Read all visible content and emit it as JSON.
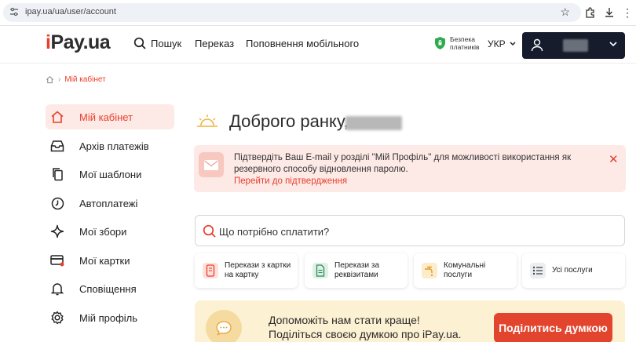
{
  "browser": {
    "url": "ipay.ua/ua/user/account"
  },
  "header": {
    "logo_prefix": "i",
    "logo_rest": "Pay.ua",
    "search_label": "Пошук",
    "nav": [
      "Переказ",
      "Поповнення мобільного"
    ],
    "safety_label": "Безпека платників",
    "language": "УКР"
  },
  "breadcrumb": {
    "current": "Мій кабінет"
  },
  "sidebar": {
    "items": [
      {
        "label": "Мій кабінет",
        "icon": "home-icon",
        "active": true
      },
      {
        "label": "Архів платежів",
        "icon": "inbox-icon",
        "active": false
      },
      {
        "label": "Мої шаблони",
        "icon": "copy-icon",
        "active": false
      },
      {
        "label": "Автоплатежі",
        "icon": "clock-icon",
        "active": false
      },
      {
        "label": "Мої збори",
        "icon": "sparkle-icon",
        "active": false
      },
      {
        "label": "Мої картки",
        "icon": "card-icon",
        "active": false
      },
      {
        "label": "Сповіщення",
        "icon": "bell-icon",
        "active": false
      },
      {
        "label": "Мій профіль",
        "icon": "gear-icon",
        "active": false
      }
    ]
  },
  "main": {
    "greeting": "Доброго ранку,",
    "alert": {
      "message": "Підтвердіть Ваш E-mail у розділі \"Мій Профіль\" для можливості використання як резервного способу відновлення паролю.",
      "link": "Перейти до підтвердження",
      "close": "✕"
    },
    "search_placeholder": "Що потрібно сплатити?",
    "services": [
      {
        "label": "Перекази з картки на картку",
        "icon": "card-transfer-icon"
      },
      {
        "label": "Перекази за реквізитами",
        "icon": "document-icon"
      },
      {
        "label": "Комунальні послуги",
        "icon": "faucet-icon"
      },
      {
        "label": "Усі послуги",
        "icon": "list-icon"
      }
    ],
    "feedback": {
      "line1": "Допоможіть нам стати краще!",
      "line2": "Поділіться своєю думкою про iPay.ua.",
      "button": "Поділитись думкою"
    }
  },
  "colors": {
    "brand": "#e8402c",
    "dark": "#161c2c",
    "alert_bg": "#fde9e6",
    "feedback_bg": "#fdf1d3"
  }
}
